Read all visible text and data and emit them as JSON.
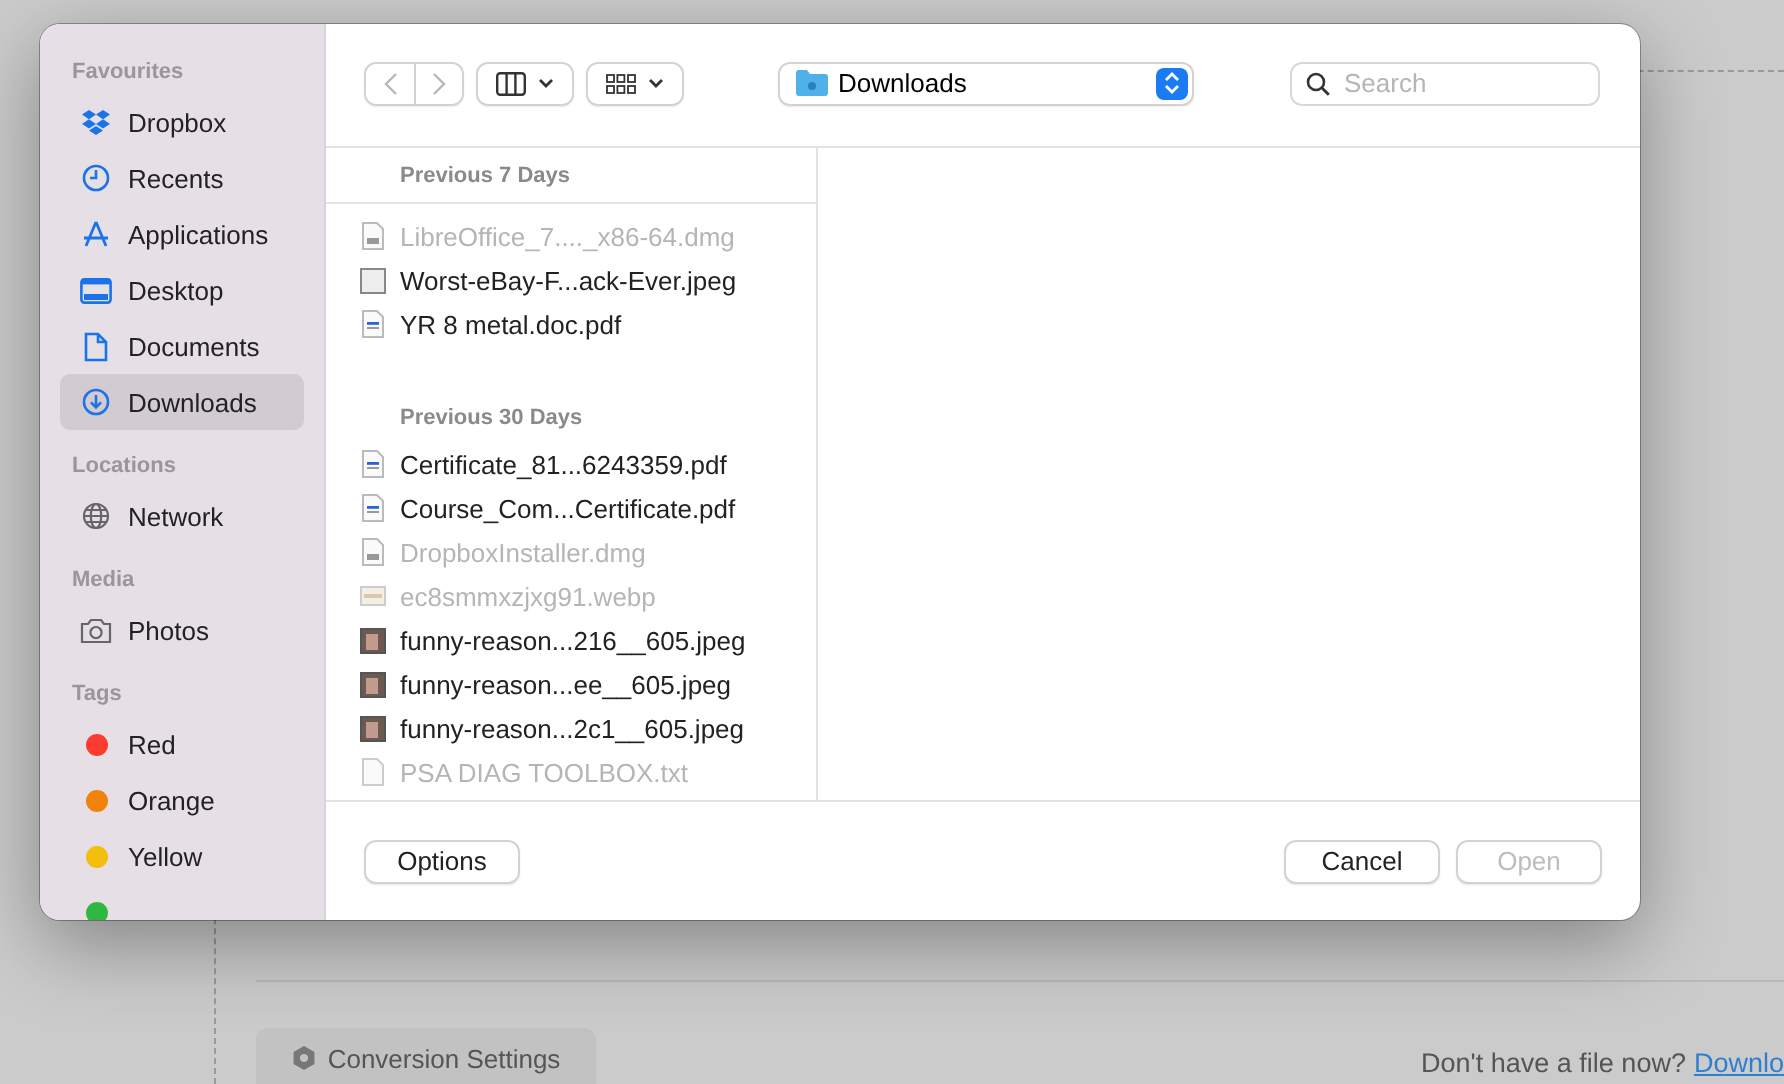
{
  "background": {
    "conversion_button": "Conversion Settings",
    "hint": "Don't have a file now?",
    "link": "Downlo"
  },
  "dialog": {
    "sidebar": {
      "sections": [
        {
          "title": "Favourites",
          "items": [
            {
              "label": "Dropbox",
              "kind": "dropbox",
              "selected": false
            },
            {
              "label": "Recents",
              "kind": "clock",
              "selected": false
            },
            {
              "label": "Applications",
              "kind": "apps",
              "selected": false
            },
            {
              "label": "Desktop",
              "kind": "desktop",
              "selected": false
            },
            {
              "label": "Documents",
              "kind": "document",
              "selected": false
            },
            {
              "label": "Downloads",
              "kind": "download",
              "selected": true
            }
          ]
        },
        {
          "title": "Locations",
          "items": [
            {
              "label": "Network",
              "kind": "globe",
              "selected": false
            }
          ]
        },
        {
          "title": "Media",
          "items": [
            {
              "label": "Photos",
              "kind": "camera",
              "selected": false
            }
          ]
        },
        {
          "title": "Tags",
          "items": [
            {
              "label": "Red",
              "kind": "tag",
              "color": "#fb3b30",
              "selected": false
            },
            {
              "label": "Orange",
              "kind": "tag",
              "color": "#f0840a",
              "selected": false
            },
            {
              "label": "Yellow",
              "kind": "tag",
              "color": "#f3be0c",
              "selected": false
            },
            {
              "kind": "tag",
              "color": "#2fb841",
              "selected": false
            }
          ]
        }
      ]
    },
    "toolbar": {
      "back_disabled": true,
      "forward_disabled": true,
      "location": "Downloads",
      "search": {
        "placeholder": "Search"
      }
    },
    "groups": [
      {
        "title": "Previous 7 Days",
        "files": [
          {
            "name": "LibreOffice_7...._x86-64.dmg",
            "kind": "disk",
            "disabled": true
          },
          {
            "name": "Worst-eBay-F...ack-Ever.jpeg",
            "kind": "blank",
            "disabled": false
          },
          {
            "name": "YR 8 metal.doc.pdf",
            "kind": "pdf",
            "disabled": false
          }
        ]
      },
      {
        "title": "Previous 30 Days",
        "files": [
          {
            "name": "Certificate_81...6243359.pdf",
            "kind": "pdf",
            "disabled": false
          },
          {
            "name": "Course_Com...Certificate.pdf",
            "kind": "pdf",
            "disabled": false
          },
          {
            "name": "DropboxInstaller.dmg",
            "kind": "disk",
            "disabled": true
          },
          {
            "name": "ec8smmxzjxg91.webp",
            "kind": "webp",
            "disabled": true
          },
          {
            "name": "funny-reason...216__605.jpeg",
            "kind": "photo",
            "disabled": false
          },
          {
            "name": "funny-reason...ee__605.jpeg",
            "kind": "photo",
            "disabled": false
          },
          {
            "name": "funny-reason...2c1__605.jpeg",
            "kind": "photo",
            "disabled": false
          },
          {
            "name": "PSA DIAG TOOLBOX.txt",
            "kind": "text",
            "disabled": true
          }
        ]
      }
    ],
    "buttons": [
      {
        "label": "Options",
        "kind": "left",
        "disabled": false
      },
      {
        "label": "Cancel",
        "kind": "right",
        "disabled": false
      },
      {
        "label": "Open",
        "kind": "right",
        "disabled": true
      }
    ]
  }
}
